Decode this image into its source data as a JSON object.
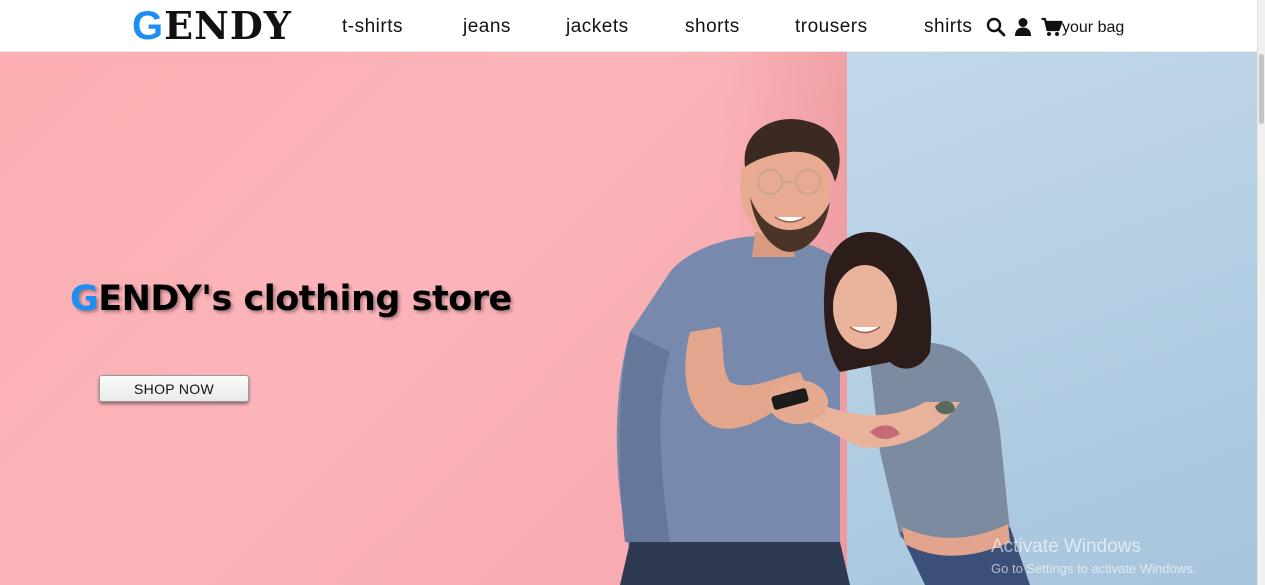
{
  "brand": {
    "logo_initial": "G",
    "logo_rest": "ENDY",
    "accent_color": "#1e8ff2"
  },
  "nav": {
    "links": [
      {
        "label": "t-shirts"
      },
      {
        "label": "jeans"
      },
      {
        "label": "jackets"
      },
      {
        "label": "shorts"
      },
      {
        "label": "trousers"
      },
      {
        "label": "shirts"
      }
    ],
    "icons": [
      "search-icon",
      "user-icon",
      "cart-icon"
    ],
    "bag_label": "your bag"
  },
  "hero": {
    "title_initial": "G",
    "title_rest": "ENDY's clothing store",
    "cta_label": "SHOP NOW",
    "bg_left_color": "#fbb5ba",
    "bg_right_color": "#b4cfe4"
  },
  "watermark": {
    "title": "Activate Windows",
    "subtitle": "Go to Settings to activate Windows."
  }
}
